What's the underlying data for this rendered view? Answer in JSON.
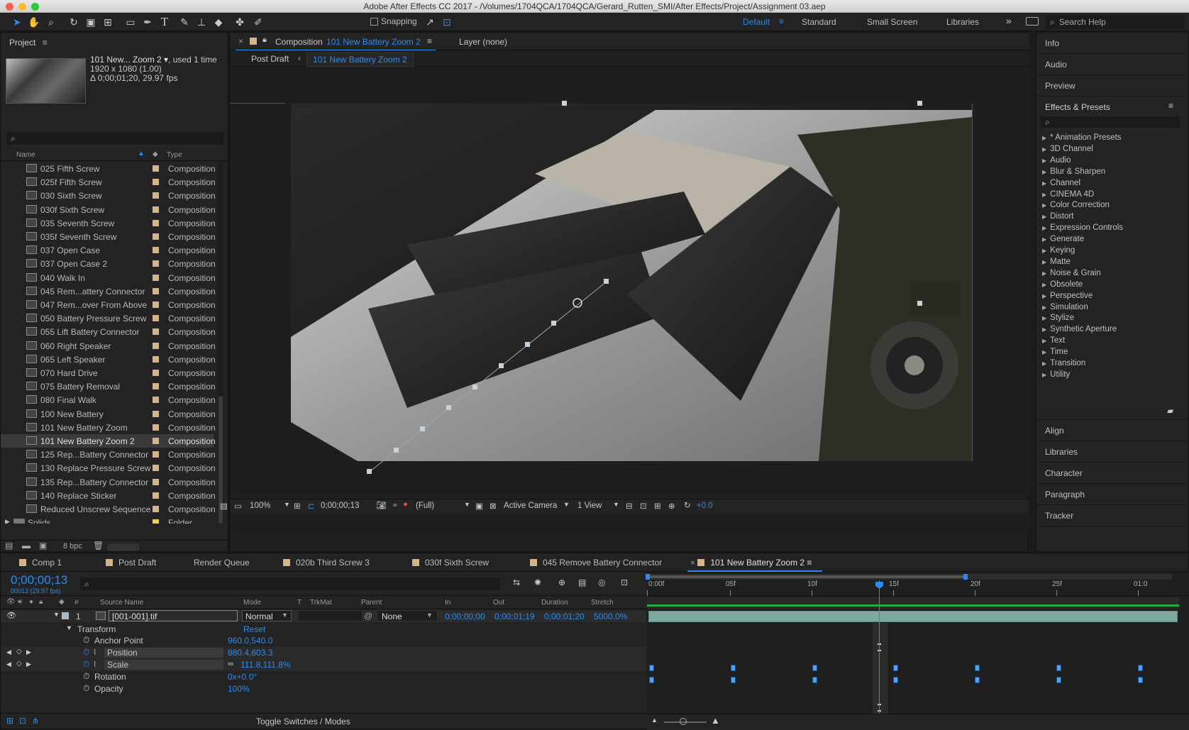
{
  "window": {
    "title": "Adobe After Effects CC 2017 - /Volumes/1704QCA/1704QCA/Gerard_Rutten_SMI/After Effects/Project/Assignment 03.aep"
  },
  "toolbar": {
    "snapping": "Snapping",
    "workspaces": [
      "Default",
      "Standard",
      "Small Screen",
      "Libraries"
    ],
    "search_placeholder": "Search Help"
  },
  "project": {
    "title": "Project",
    "item_name": "101 New... Zoom 2 ▾",
    "used": ", used 1 time",
    "dimensions": "1920 x 1080 (1.00)",
    "duration": "Δ 0;00;01;20, 29.97 fps",
    "columns": {
      "name": "Name",
      "type": "Type"
    },
    "items": [
      {
        "name": "025 Fifth Screw",
        "type": "Composition"
      },
      {
        "name": "025f Fifth Screw",
        "type": "Composition"
      },
      {
        "name": "030 Sixth Screw",
        "type": "Composition"
      },
      {
        "name": "030f Sixth Screw",
        "type": "Composition"
      },
      {
        "name": "035 Seventh Screw",
        "type": "Composition"
      },
      {
        "name": "035f Seventh Screw",
        "type": "Composition"
      },
      {
        "name": "037 Open Case",
        "type": "Composition"
      },
      {
        "name": "037 Open Case 2",
        "type": "Composition"
      },
      {
        "name": "040 Walk In",
        "type": "Composition"
      },
      {
        "name": "045 Rem...attery Connector",
        "type": "Composition"
      },
      {
        "name": "047 Rem...over From Above",
        "type": "Composition"
      },
      {
        "name": "050 Battery Pressure Screw",
        "type": "Composition"
      },
      {
        "name": "055 Lift Battery Connector",
        "type": "Composition"
      },
      {
        "name": "060 Right Speaker",
        "type": "Composition"
      },
      {
        "name": "065 Left Speaker",
        "type": "Composition"
      },
      {
        "name": "070 Hard Drive",
        "type": "Composition"
      },
      {
        "name": "075 Battery Removal",
        "type": "Composition"
      },
      {
        "name": "080 Final Walk",
        "type": "Composition"
      },
      {
        "name": "100 New Battery",
        "type": "Composition"
      },
      {
        "name": "101 New Battery Zoom",
        "type": "Composition"
      },
      {
        "name": "101 New Battery Zoom 2",
        "type": "Composition"
      },
      {
        "name": "125 Rep...Battery Connector",
        "type": "Composition"
      },
      {
        "name": "130 Replace Pressure Screw",
        "type": "Composition"
      },
      {
        "name": "135 Rep...Battery Connector",
        "type": "Composition"
      },
      {
        "name": "140 Replace Sticker",
        "type": "Composition"
      },
      {
        "name": "Reduced Unscrew Sequence",
        "type": "Composition"
      },
      {
        "name": "Solids",
        "type": "Folder"
      }
    ],
    "bpc": "8 bpc"
  },
  "composition": {
    "tab_prefix": "Composition",
    "tab_name": "101 New Battery Zoom 2",
    "layer_tab": "Layer (none)",
    "breadcrumb": [
      "Post Draft",
      "101 New Battery Zoom 2"
    ],
    "zoom": "100%",
    "timecode": "0;00;00;13",
    "resolution": "(Full)",
    "camera": "Active Camera",
    "view": "1 View",
    "exposure": "+0.0"
  },
  "right_panels": {
    "top": [
      "Info",
      "Audio",
      "Preview"
    ],
    "effects_title": "Effects & Presets",
    "effects": [
      "* Animation Presets",
      "3D Channel",
      "Audio",
      "Blur & Sharpen",
      "Channel",
      "CINEMA 4D",
      "Color Correction",
      "Distort",
      "Expression Controls",
      "Generate",
      "Keying",
      "Matte",
      "Noise & Grain",
      "Obsolete",
      "Perspective",
      "Simulation",
      "Stylize",
      "Synthetic Aperture",
      "Text",
      "Time",
      "Transition",
      "Utility"
    ],
    "bottom": [
      "Align",
      "Libraries",
      "Character",
      "Paragraph",
      "Tracker"
    ]
  },
  "timeline": {
    "tabs": [
      {
        "label": "Comp 1",
        "color": "#d5b48c"
      },
      {
        "label": "Post Draft",
        "color": "#d5b48c"
      },
      {
        "label": "Render Queue",
        "color": ""
      },
      {
        "label": "020b Third Screw 3",
        "color": "#d5b48c"
      },
      {
        "label": "030f Sixth Screw",
        "color": "#d5b48c"
      },
      {
        "label": "045 Remove Battery Connector",
        "color": "#d5b48c"
      },
      {
        "label": "101 New Battery Zoom 2",
        "color": "#d5b48c"
      }
    ],
    "current_time": "0;00;00;13",
    "frame_info": "00013 (29.97 fps)",
    "columns": {
      "source": "Source Name",
      "mode": "Mode",
      "t": "T",
      "trkmat": "TrkMat",
      "parent": "Parent",
      "in": "In",
      "out": "Out",
      "duration": "Duration",
      "stretch": "Stretch"
    },
    "layer": {
      "num": "1",
      "name": "[001-001].tif",
      "mode": "Normal",
      "parent": "None",
      "in": "0;00;00;00",
      "out": "0;00;01;19",
      "duration": "0;00;01;20",
      "stretch": "5000.0%"
    },
    "transform": {
      "label": "Transform",
      "reset": "Reset"
    },
    "properties": [
      {
        "name": "Anchor Point",
        "value": "960.0,540.0"
      },
      {
        "name": "Position",
        "value": "880.4,603.3"
      },
      {
        "name": "Scale",
        "value": "111.8,111.8%"
      },
      {
        "name": "Rotation",
        "value": "0x+0.0°"
      },
      {
        "name": "Opacity",
        "value": "100%"
      }
    ],
    "ruler": [
      "0:00f",
      "05f",
      "10f",
      "15f",
      "20f",
      "25f",
      "01:0"
    ],
    "toggle": "Toggle Switches / Modes"
  },
  "colors": {
    "accent": "#2d8ceb",
    "keyframe": "#4ba3ff",
    "track": "#7ea99f",
    "label_tan": "#d5b48c",
    "folder_yellow": "#e8d44d"
  }
}
